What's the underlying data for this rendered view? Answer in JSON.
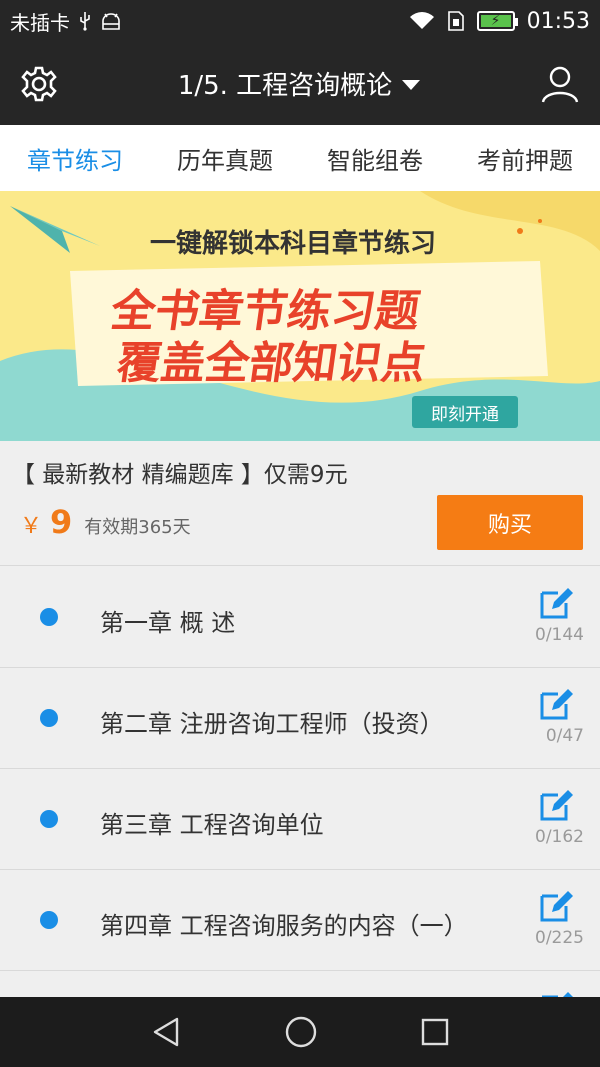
{
  "status": {
    "carrier": "未插卡",
    "time": "01:53",
    "icons": [
      "usb-icon",
      "android-debug-icon",
      "wifi-icon",
      "sim-icon",
      "battery-icon"
    ]
  },
  "app_bar": {
    "title": "1/5. 工程咨询概论",
    "icons": [
      "gear-icon",
      "user-icon"
    ]
  },
  "tabs": [
    {
      "label": "章节练习",
      "active": true
    },
    {
      "label": "历年真题",
      "active": false
    },
    {
      "label": "智能组卷",
      "active": false
    },
    {
      "label": "考前押题",
      "active": false
    }
  ],
  "banner": {
    "headline": "一键解锁本科目章节练习",
    "line1": "全书章节练习题",
    "line2": "覆盖全部知识点",
    "button": "即刻开通"
  },
  "promo": {
    "title": "【 最新教材 精编题库 】仅需9元",
    "currency": "￥",
    "price": "9",
    "validity": "有效期365天",
    "buy_label": "购买"
  },
  "chapters": [
    {
      "name": "第一章 概 述",
      "count": "0/144"
    },
    {
      "name": "第二章 注册咨询工程师（投资）",
      "count": "0/47"
    },
    {
      "name": "第三章 工程咨询单位",
      "count": "0/162"
    },
    {
      "name": "第四章 工程咨询服务的内容（一）",
      "count": "0/225"
    }
  ],
  "colors": {
    "accent": "#1a8ee6",
    "buy": "#f57c14",
    "price": "#f07a19",
    "dark_bar": "#262626"
  }
}
